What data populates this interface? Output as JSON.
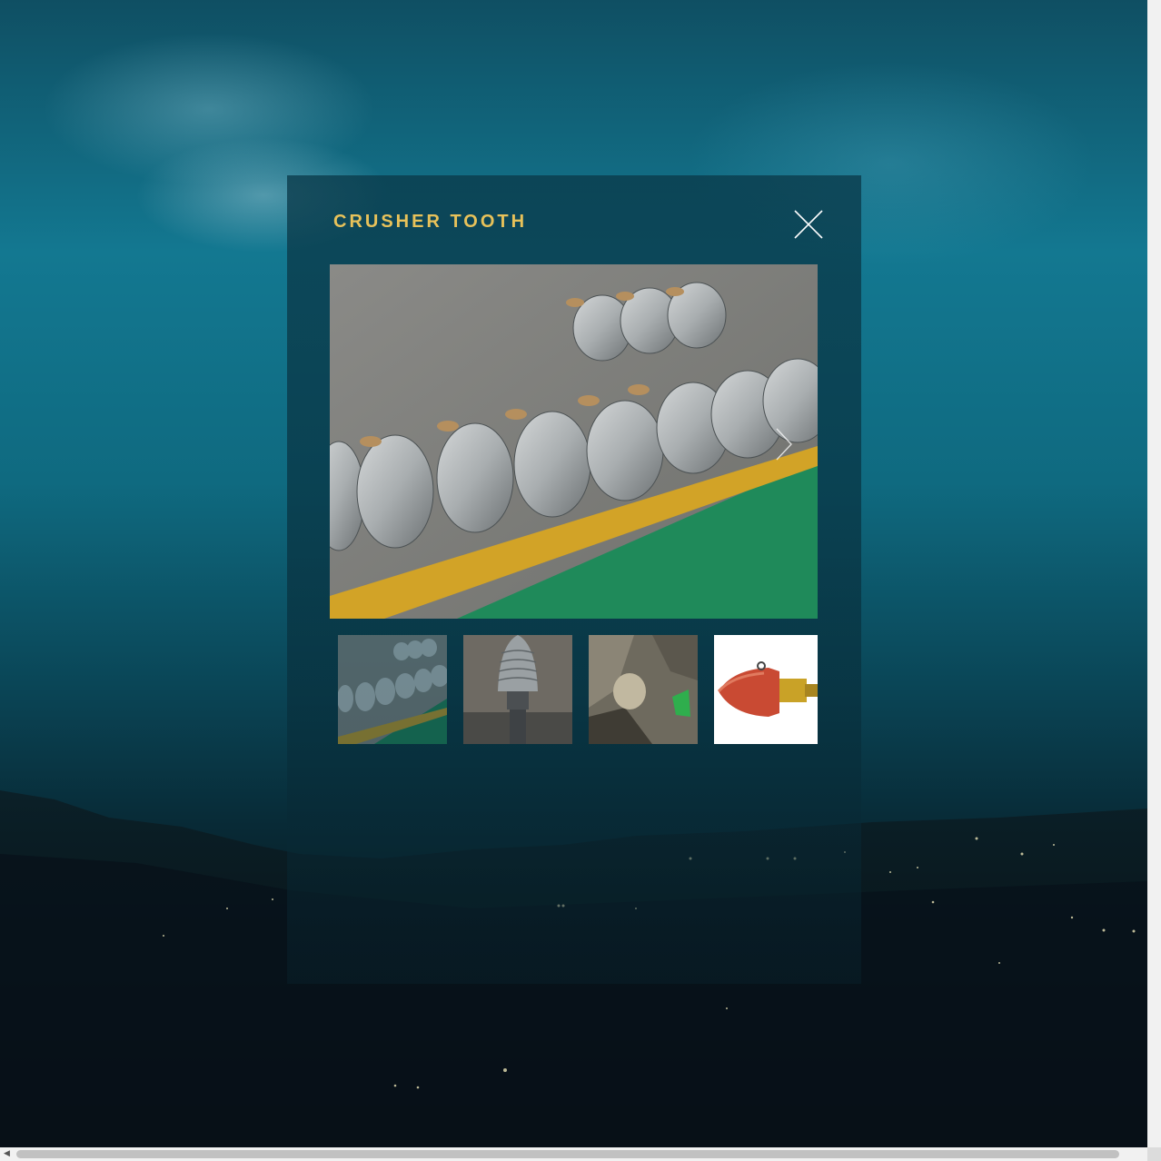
{
  "modal": {
    "title": "CRUSHER TOOTH",
    "close_icon": "close-icon",
    "next_icon": "chevron-right-icon"
  },
  "gallery": {
    "main_image": "photo-crusher-teeth-on-floor",
    "thumbnails": [
      "photo-crusher-teeth-on-floor",
      "photo-single-crusher-tooth",
      "photo-tooth-in-rock",
      "photo-red-capped-tooth"
    ]
  },
  "colors": {
    "title": "#e8c25a",
    "panel": "#0a3a4a",
    "accent_floor_green": "#1f8a5a",
    "accent_floor_yellow": "#d2a327"
  }
}
